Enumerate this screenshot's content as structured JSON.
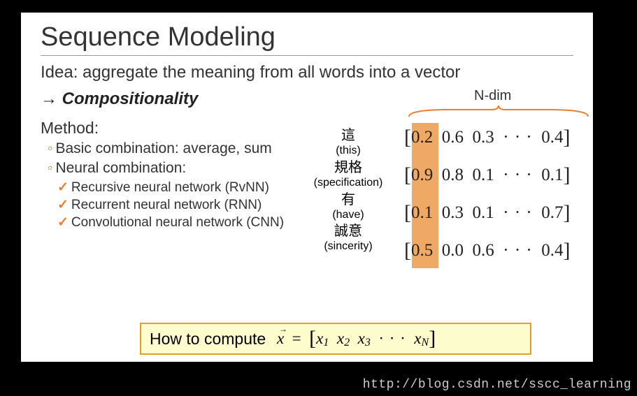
{
  "title": "Sequence Modeling",
  "idea": "Idea: aggregate the meaning from all words into a vector",
  "compositionality": "Compositionality",
  "method_label": "Method:",
  "bullets1": {
    "a": "Basic combination: average, sum",
    "b": "Neural combination:"
  },
  "bullets2": {
    "a": "Recursive neural network (RvNN)",
    "b": "Recurrent neural network (RNN)",
    "c": "Convolutional neural network (CNN)"
  },
  "ndim_label": "N-dim",
  "words": {
    "r1": {
      "word": "這",
      "trans": "(this)"
    },
    "r2": {
      "word": "規格",
      "trans": "(specification)"
    },
    "r3": {
      "word": "有",
      "trans": "(have)"
    },
    "r4": {
      "word": "誠意",
      "trans": "(sincerity)"
    }
  },
  "matrix": {
    "r1": {
      "c1": "0.2",
      "c2": "0.6",
      "c3": "0.3",
      "c4": "· · ·",
      "c5": "0.4"
    },
    "r2": {
      "c1": "0.9",
      "c2": "0.8",
      "c3": "0.1",
      "c4": "· · ·",
      "c5": "0.1"
    },
    "r3": {
      "c1": "0.1",
      "c2": "0.3",
      "c3": "0.1",
      "c4": "· · ·",
      "c5": "0.7"
    },
    "r4": {
      "c1": "0.5",
      "c2": "0.0",
      "c3": "0.6",
      "c4": "· · ·",
      "c5": "0.4"
    }
  },
  "footer_label": "How to compute",
  "vector": {
    "sym": "x",
    "eq": "=",
    "x1": "x",
    "s1": "1",
    "x2": "x",
    "s2": "2",
    "x3": "x",
    "s3": "3",
    "dots": "· · ·",
    "xn": "x",
    "sn": "N"
  },
  "watermark": "http://blog.csdn.net/sscc_learning"
}
